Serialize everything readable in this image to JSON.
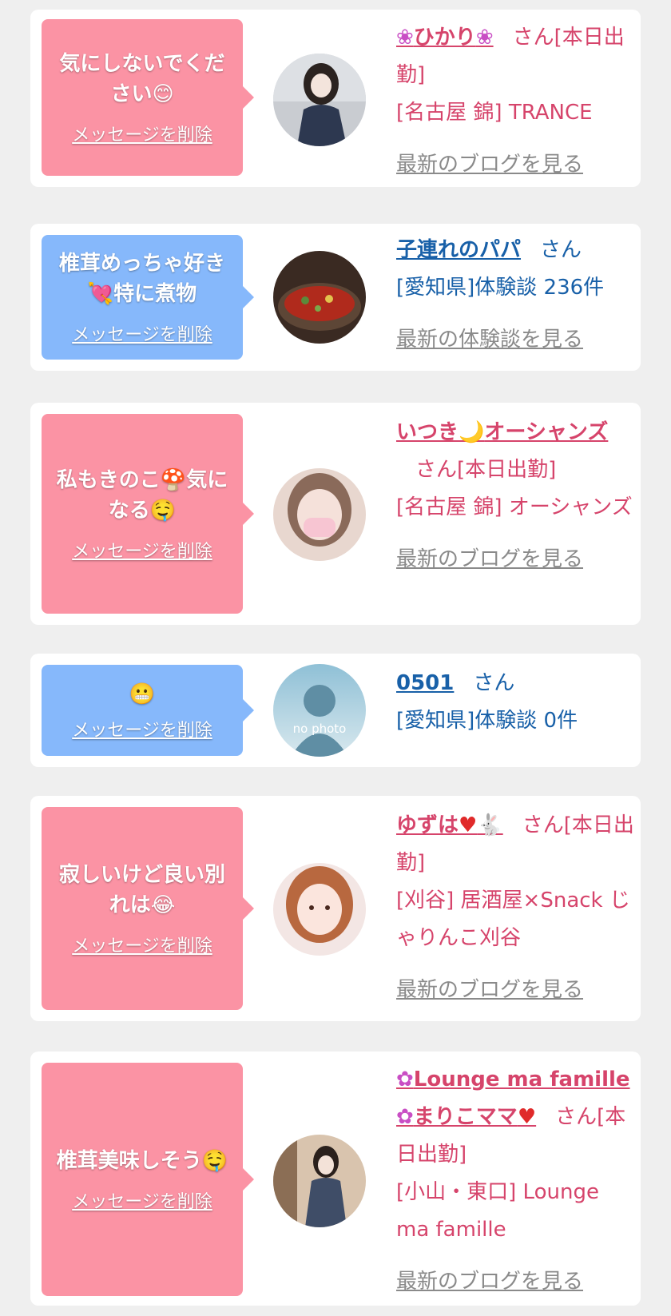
{
  "delete_label": "メッセージを削除",
  "suffix_san": "さん",
  "items": [
    {
      "type": "girl",
      "message": "気にしないでください",
      "message_icon": "😊",
      "name_prefix_icon": "❀",
      "name": "ひかり",
      "name_suffix_icon": "❀",
      "status": "[本日出勤]",
      "shop": "[名古屋 錦] TRANCE",
      "link": "最新のブログを見る"
    },
    {
      "type": "user",
      "message": "椎茸めっちゃ好き",
      "message_icon": "💘",
      "message2": "特に煮物",
      "name": "子連れのパパ",
      "area": "[愛知県]体験談 236件",
      "link": "最新の体験談を見る"
    },
    {
      "type": "girl",
      "message": "私もきのこ",
      "message_icon": "🍄",
      "message2": "気になる",
      "message_icon2": "🤤",
      "name": "いつき",
      "name_mid_icon": "🌙",
      "name2": "オーシャンズ",
      "status": "[本日出勤]",
      "shop": "[名古屋 錦] オーシャンズ",
      "link": "最新のブログを見る"
    },
    {
      "type": "user",
      "message_icon": "😬",
      "name": "0501",
      "area": "[愛知県]体験談 0件",
      "avatar_text": "no photo"
    },
    {
      "type": "girl",
      "message": "寂しいけど良い別れは",
      "message_icon": "😂",
      "name": "ゆずは",
      "name_suffix_icon": "♥",
      "name_suffix_icon2": "🐇",
      "status": "[本日出勤]",
      "shop": "[刈谷] 居酒屋×Snack じゃりんこ刈谷",
      "link": "最新のブログを見る"
    },
    {
      "type": "girl",
      "message": "椎茸美味しそう",
      "message_icon": "🤤",
      "name_prefix_icon": "✿",
      "name": "Lounge ma famille",
      "name2_prefix_icon": "✿",
      "name2": "まりこママ",
      "name2_suffix_icon": "♥",
      "status": "[本日出勤]",
      "shop": "[小山・東口] Lounge ma famille",
      "link": "最新のブログを見る"
    }
  ],
  "colors": {
    "bubble_pink": "#fb93a4",
    "bubble_blue": "#86b8fb",
    "text_pink": "#d6446b",
    "text_blue": "#1860a8",
    "link_gray": "#8a8a8a",
    "background": "#efefef"
  }
}
